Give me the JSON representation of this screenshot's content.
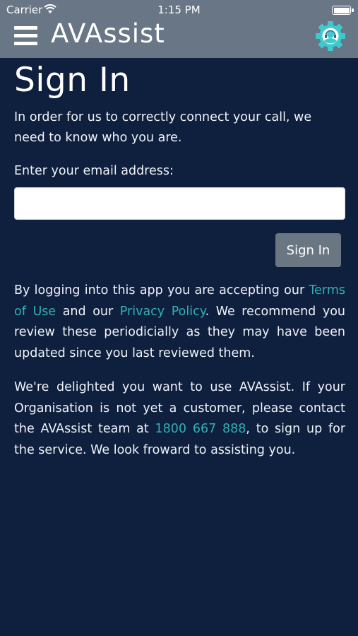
{
  "status_bar": {
    "carrier": "Carrier",
    "time": "1:15 PM",
    "wifi_icon": "wifi-icon",
    "battery_icon": "battery-icon"
  },
  "header": {
    "title": "AVAssist",
    "menu_icon": "hamburger-menu-icon",
    "settings_icon": "gear-headset-icon"
  },
  "main": {
    "title": "Sign In",
    "intro": "In order for us to correctly connect your call, we need to know who you are.",
    "email_label": "Enter your email address:",
    "email_value": "",
    "email_placeholder": "",
    "signin_label": "Sign In",
    "terms": {
      "prefix": "By logging into this app you are accepting our ",
      "terms_link": "Terms of Use",
      "middle": " and our ",
      "privacy_link": "Privacy Policy",
      "suffix": ". We recommend you review these periodicially as they may have been updated since you last reviewed them."
    },
    "contact": {
      "prefix": "We're delighted you want to use AVAssist. If your Organisation is not yet a customer, please contact the AVAssist team at ",
      "phone_link": "1800 667 888",
      "suffix": ", to sign up for the service. We look froward to assisting you."
    }
  },
  "colors": {
    "background": "#0f1f3e",
    "header": "#687686",
    "accent": "#31b0b4",
    "button": "#6b7683"
  }
}
